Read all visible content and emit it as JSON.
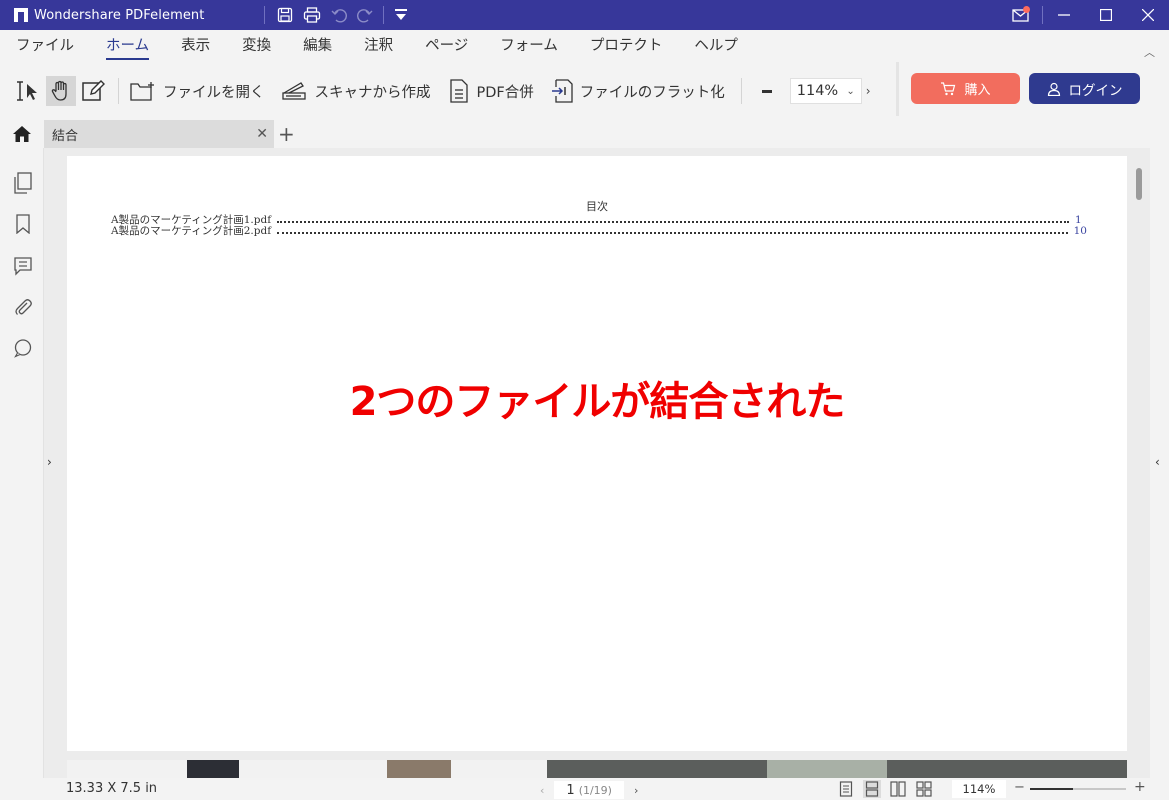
{
  "titlebar": {
    "app_title": "Wondershare PDFelement"
  },
  "menu": {
    "items": [
      "ファイル",
      "ホーム",
      "表示",
      "変換",
      "編集",
      "注釈",
      "ページ",
      "フォーム",
      "プロテクト",
      "ヘルプ"
    ],
    "active": "ホーム"
  },
  "toolbar": {
    "open_file": "ファイルを開く",
    "scanner": "スキャナから作成",
    "merge": "PDF合併",
    "flatten": "ファイルのフラット化",
    "zoom": "114%",
    "buy": "購入",
    "login": "ログイン",
    "buy_color": "#f26d5e",
    "login_color": "#2f3a8f"
  },
  "tab": {
    "name": "結合"
  },
  "document": {
    "toc_title": "目次",
    "toc": [
      {
        "title": "A製品のマーケティング計画1.pdf",
        "page": "1"
      },
      {
        "title": "A製品のマーケティング計画2.pdf",
        "page": "10"
      }
    ],
    "caption": "2つのファイルが結合された",
    "caption_color": "#f00000"
  },
  "status": {
    "page_size": "13.33 X 7.5 in",
    "current_page": "1",
    "page_count": "(1/19)",
    "zoom": "114%",
    "zoom_level": 0.45
  }
}
